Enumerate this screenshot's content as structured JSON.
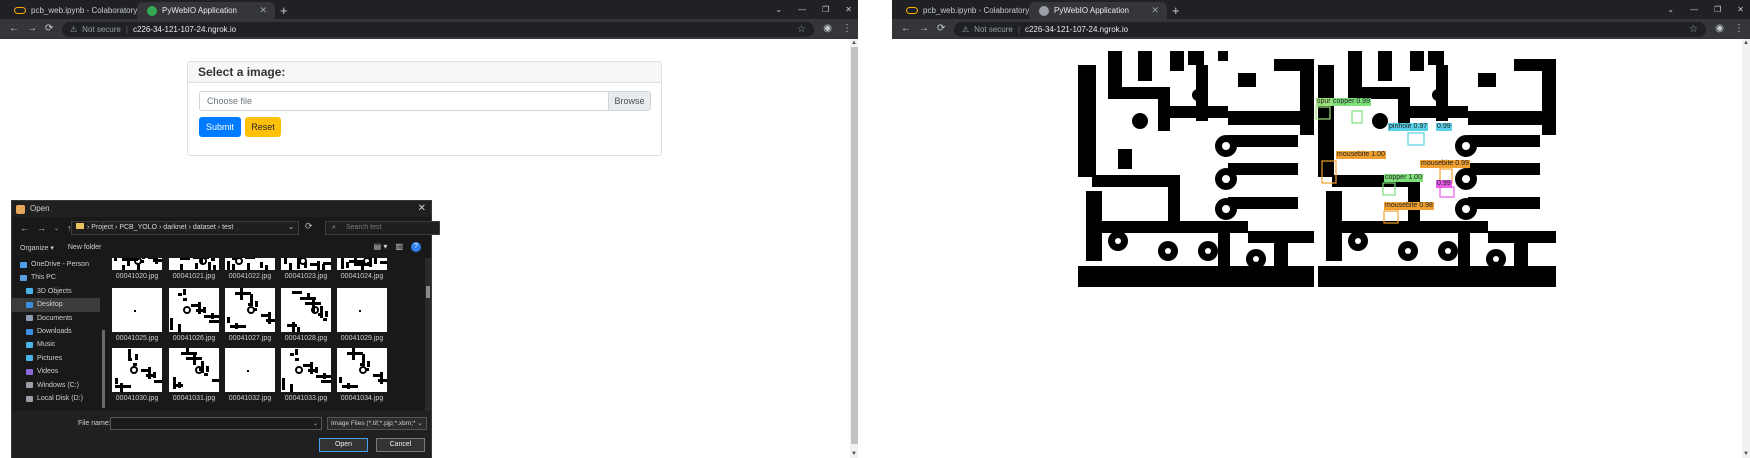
{
  "left_window": {
    "tabs": [
      {
        "label": "pcb_web.ipynb - Colaboratory",
        "icon": "colab-icon",
        "active": false
      },
      {
        "label": "PyWebIO Application",
        "icon": "pywebio-icon",
        "active": true
      }
    ],
    "address": {
      "security": "Not secure",
      "url": "c226-34-121-107-24.ngrok.io"
    },
    "card": {
      "title": "Select a image:",
      "file_placeholder": "Choose file",
      "browse_label": "Browse",
      "submit_label": "Submit",
      "reset_label": "Reset"
    },
    "open_dialog": {
      "title": "Open",
      "breadcrumb": [
        "Project",
        "PCB_YOLO",
        "darknet",
        "dataset",
        "test"
      ],
      "search_placeholder": "Search test",
      "organize_label": "Organize",
      "new_folder_label": "New folder",
      "sidebar": [
        {
          "label": "OneDrive - Person",
          "icon": "cloud-icon",
          "color": "#4a9eea",
          "selected": false
        },
        {
          "label": "This PC",
          "icon": "pc-icon",
          "color": "#5aa0e0",
          "selected": false
        },
        {
          "label": "3D Objects",
          "icon": "cube-icon",
          "color": "#4ab4e8",
          "selected": false
        },
        {
          "label": "Desktop",
          "icon": "desktop-icon",
          "color": "#3d8ee0",
          "selected": true
        },
        {
          "label": "Documents",
          "icon": "documents-icon",
          "color": "#8a9cb0",
          "selected": false
        },
        {
          "label": "Downloads",
          "icon": "download-icon",
          "color": "#3d8ee0",
          "selected": false
        },
        {
          "label": "Music",
          "icon": "music-icon",
          "color": "#4ab4e8",
          "selected": false
        },
        {
          "label": "Pictures",
          "icon": "pictures-icon",
          "color": "#4ab4e8",
          "selected": false
        },
        {
          "label": "Videos",
          "icon": "videos-icon",
          "color": "#8a6ad8",
          "selected": false
        },
        {
          "label": "Windows (C:)",
          "icon": "drive-icon",
          "color": "#9aa0a6",
          "selected": false
        },
        {
          "label": "Local Disk (D:)",
          "icon": "drive-icon",
          "color": "#9aa0a6",
          "selected": false
        }
      ],
      "files": [
        "00041020.jpg",
        "00041021.jpg",
        "00041022.jpg",
        "00041023.jpg",
        "00041024.jpg",
        "00041025.jpg",
        "00041026.jpg",
        "00041027.jpg",
        "00041028.jpg",
        "00041029.jpg",
        "00041030.jpg",
        "00041031.jpg",
        "00041032.jpg",
        "00041033.jpg",
        "00041034.jpg"
      ],
      "file_name_label": "File name:",
      "file_name_value": "",
      "file_type": "Image Files (*.tif;*.pjp;*.xbm;*.jxl",
      "open_label": "Open",
      "cancel_label": "Cancel"
    }
  },
  "right_window": {
    "tabs": [
      {
        "label": "pcb_web.ipynb - Colaboratory",
        "icon": "colab-icon",
        "active": false
      },
      {
        "label": "PyWebIO Application",
        "icon": "pywebio-icon",
        "active": true
      }
    ],
    "address": {
      "security": "Not secure",
      "url": "c226-34-121-107-24.ngrok.io"
    },
    "detections": [
      {
        "text": "spur",
        "color": "#9be07a"
      },
      {
        "text": "copper  0.99",
        "color": "#7ee07a"
      },
      {
        "text": "pinhole  0.97",
        "color": "#5ad0e8"
      },
      {
        "text": "0.99",
        "color": "#5ad0e8"
      },
      {
        "text": "mousebite  1.00",
        "color": "#f0a030"
      },
      {
        "text": "mousebite  0.99",
        "color": "#f0a030"
      },
      {
        "text": "copper  1.00",
        "color": "#7ee07a"
      },
      {
        "text": "0.99",
        "color": "#e85ae8"
      },
      {
        "text": "mousebite  0.98",
        "color": "#f0a030"
      }
    ]
  }
}
